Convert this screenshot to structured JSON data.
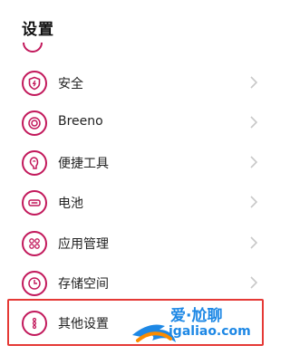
{
  "header": {
    "title": "设置"
  },
  "items": [
    {
      "label": "安全",
      "icon": "shield-icon"
    },
    {
      "label": "Breeno",
      "icon": "breeno-icon"
    },
    {
      "label": "便捷工具",
      "icon": "tool-icon"
    },
    {
      "label": "电池",
      "icon": "battery-icon"
    },
    {
      "label": "应用管理",
      "icon": "apps-grid-icon"
    },
    {
      "label": "存储空间",
      "icon": "storage-icon"
    },
    {
      "label": "其他设置",
      "icon": "more-dots-icon"
    }
  ],
  "watermark": {
    "line1": "爱·尬聊",
    "line2": "igaliao.com"
  },
  "colors": {
    "accent": "#c2185b",
    "highlight": "#e53935",
    "watermark": "#1e88e5"
  }
}
